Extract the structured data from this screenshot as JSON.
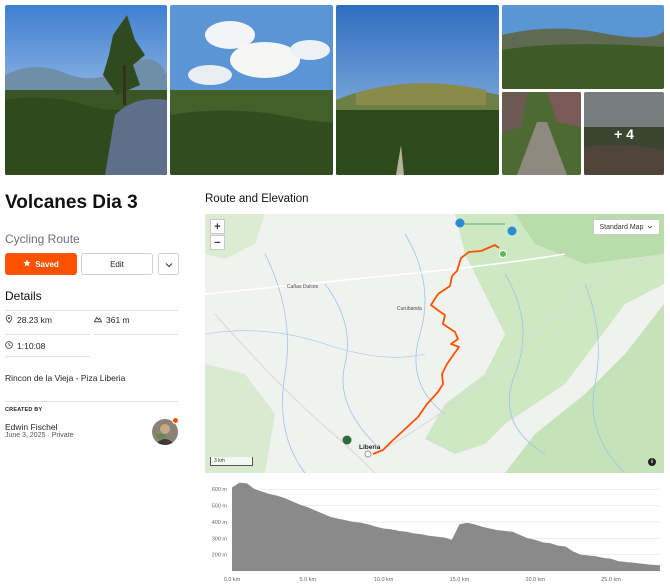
{
  "photos": {
    "more_label": "+ 4"
  },
  "route": {
    "title": "Volcanes Dia 3",
    "type": "Cycling Route",
    "saved_label": "Saved",
    "edit_label": "Edit",
    "details_heading": "Details",
    "distance": "28.23 km",
    "elevation_gain": "361 m",
    "duration": "1:10:08",
    "description": "Rincon de la Vieja - Piza Liberia",
    "created_by_label": "CREATED BY",
    "author": "Edwin Fischel",
    "date": "June 3, 2025",
    "visibility": "Private"
  },
  "map": {
    "heading": "Route and Elevation",
    "zoom_in": "+",
    "zoom_out": "−",
    "map_type": "Standard Map",
    "scale": "3 km",
    "info": "i",
    "places": {
      "canas_dulces": "Cañas Dulces",
      "curubanda": "Curubanda",
      "liberia": "Liberia"
    }
  },
  "elevation_chart": {
    "y_ticks": [
      "600 m",
      "500 m",
      "400 m",
      "300 m",
      "200 m"
    ],
    "x_ticks": [
      "0.0 km",
      "5.0 km",
      "10.0 km",
      "15.0 km",
      "20.0 km",
      "25.0 km"
    ]
  },
  "chart_data": {
    "type": "area",
    "title": "",
    "xlabel": "",
    "ylabel": "",
    "x_unit": "km",
    "y_unit": "m",
    "xlim": [
      0,
      28.23
    ],
    "ylim": [
      100,
      650
    ],
    "x": [
      0,
      0.5,
      1,
      1.5,
      2,
      2.5,
      3,
      3.5,
      4,
      4.5,
      5,
      5.5,
      6,
      6.5,
      7,
      7.5,
      8,
      8.5,
      9,
      9.5,
      10,
      10.5,
      11,
      11.5,
      12,
      12.5,
      13,
      13.5,
      14,
      14.5,
      15,
      15.5,
      16,
      16.5,
      17,
      17.5,
      18,
      18.5,
      19,
      19.5,
      20,
      20.5,
      21,
      21.5,
      22,
      22.5,
      23,
      23.5,
      24,
      24.5,
      25,
      25.5,
      26,
      26.5,
      27,
      27.5,
      28.23
    ],
    "values": [
      610,
      640,
      635,
      600,
      585,
      570,
      560,
      545,
      525,
      505,
      490,
      470,
      450,
      430,
      420,
      410,
      400,
      395,
      385,
      370,
      360,
      355,
      345,
      340,
      330,
      325,
      315,
      310,
      305,
      290,
      385,
      395,
      385,
      370,
      360,
      350,
      345,
      340,
      320,
      300,
      290,
      275,
      270,
      255,
      250,
      220,
      200,
      195,
      190,
      180,
      175,
      160,
      155,
      150,
      145,
      140,
      135
    ],
    "color": "#8a8a8a"
  }
}
